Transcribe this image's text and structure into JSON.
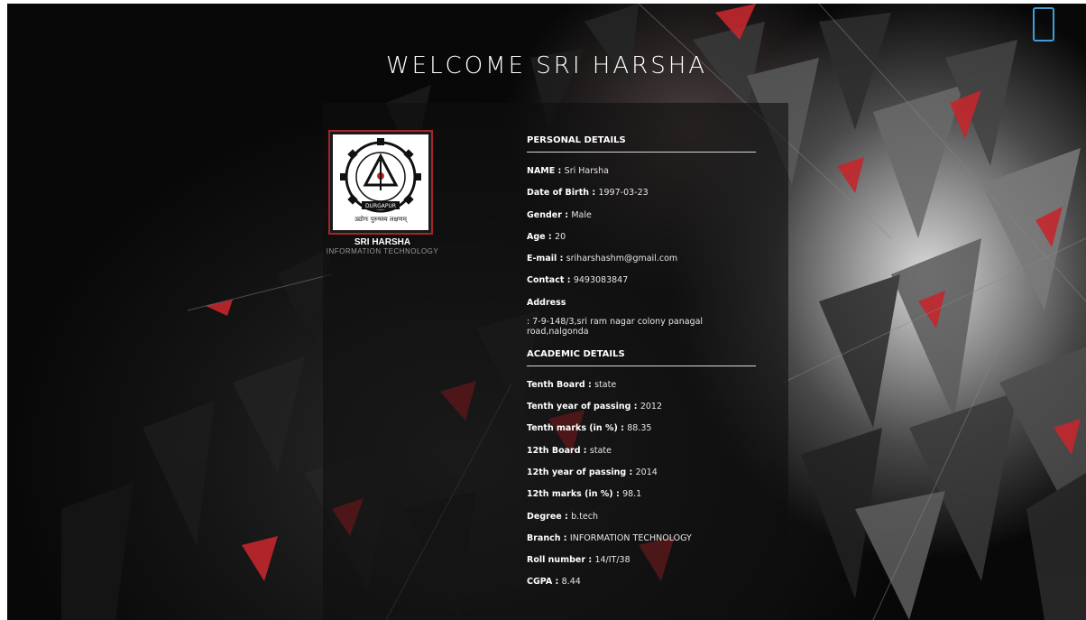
{
  "header": {
    "title": "WELCOME  SRI  HARSHA"
  },
  "profile": {
    "name": "SRI HARSHA",
    "department": "INFORMATION TECHNOLOGY",
    "logo_top_text": "NATIONAL INSTITUTE OF TECHNOLOGY",
    "logo_banner_text": "DURGAPUR",
    "logo_bottom_text": "उद्योगः पुरुषस्य लक्षणम्"
  },
  "personal": {
    "heading": "PERSONAL DETAILS",
    "rows": [
      {
        "key": "NAME",
        "value": "Sri Harsha"
      },
      {
        "key": "Date of Birth",
        "value": "1997-03-23"
      },
      {
        "key": "Gender",
        "value": "Male"
      },
      {
        "key": "Age",
        "value": "20"
      },
      {
        "key": "E-mail",
        "value": "sriharshashm@gmail.com"
      },
      {
        "key": "Contact",
        "value": "9493083847"
      }
    ],
    "address_label": "Address",
    "address_value": ": 7-9-148/3,sri ram nagar colony panagal road,nalgonda"
  },
  "academic": {
    "heading": "ACADEMIC DETAILS",
    "rows": [
      {
        "key": "Tenth Board",
        "value": "state"
      },
      {
        "key": "Tenth year of passing",
        "value": "2012"
      },
      {
        "key": "Tenth marks (in %)",
        "value": "88.35"
      },
      {
        "key": "12th Board",
        "value": "state"
      },
      {
        "key": "12th year of passing",
        "value": "2014"
      },
      {
        "key": "12th marks (in %)",
        "value": "98.1"
      },
      {
        "key": "Degree",
        "value": "b.tech"
      },
      {
        "key": "Branch",
        "value": "INFORMATION TECHNOLOGY"
      },
      {
        "key": "Roll number",
        "value": "14/IT/38"
      },
      {
        "key": "CGPA",
        "value": "8.44"
      }
    ]
  },
  "colors": {
    "accent_red": "#a4262c",
    "corner_icon_blue": "#3c9fd8",
    "text": "#ffffff"
  },
  "icons": {
    "corner": "mobile-device-icon",
    "logo": "institute-emblem-icon"
  }
}
